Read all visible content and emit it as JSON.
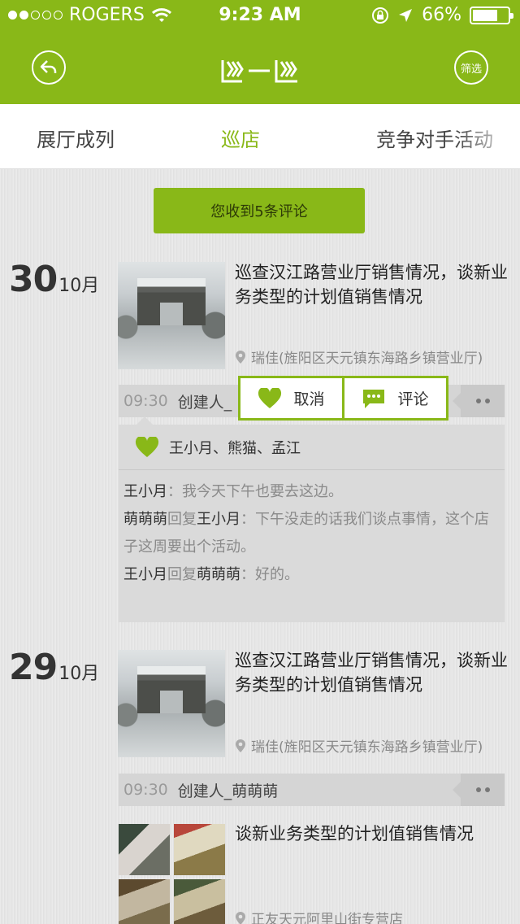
{
  "status_bar": {
    "carrier": "ROGERS",
    "time": "9:23 AM",
    "battery": "66%",
    "battery_level": 0.66,
    "signal_dots_filled": 2,
    "signal_dots_total": 5
  },
  "nav": {
    "filter_label": "筛选",
    "back_icon": "back-arrow-icon",
    "logo_icon": "app-logo"
  },
  "tabs": [
    {
      "label": "展厅成列"
    },
    {
      "label": "巡店"
    },
    {
      "label": "竞争对手活动"
    }
  ],
  "notice": "您收到5条评论",
  "posts": [
    {
      "day": "30",
      "month": "10月",
      "title": "巡查汉江路营业厅销售情况，谈新业务类型的计划值销售情况",
      "location": "瑞佳(旌阳区天元镇东海路乡镇营业厅)",
      "time": "09:30",
      "creator": "创建人_",
      "likes": "王小月、熊猫、孟江",
      "comments": [
        {
          "name": "王小月",
          "sep": "：",
          "text": "我今天下午也要去这边。"
        },
        {
          "name": "萌萌萌",
          "reply_word": "回复",
          "target": "王小月",
          "sep": "：",
          "text": "下午没走的话我们谈点事情，这个店子这周要出个活动。"
        },
        {
          "name": "王小月",
          "reply_word": "回复",
          "target": "萌萌萌",
          "sep": "：",
          "text": "好的。"
        }
      ]
    },
    {
      "day": "29",
      "month": "10月",
      "title": "巡查汉江路营业厅销售情况，谈新业务类型的计划值销售情况",
      "location": "瑞佳(旌阳区天元镇东海路乡镇营业厅)",
      "time": "09:30",
      "creator": "创建人_萌萌萌"
    },
    {
      "title": "谈新业务类型的计划值销售情况",
      "location": "正友天元阿里山街专营店"
    }
  ],
  "popup": {
    "cancel_label": "取消",
    "comment_label": "评论"
  },
  "colors": {
    "brand_green": "#89b818",
    "background": "#e6e6e6"
  }
}
